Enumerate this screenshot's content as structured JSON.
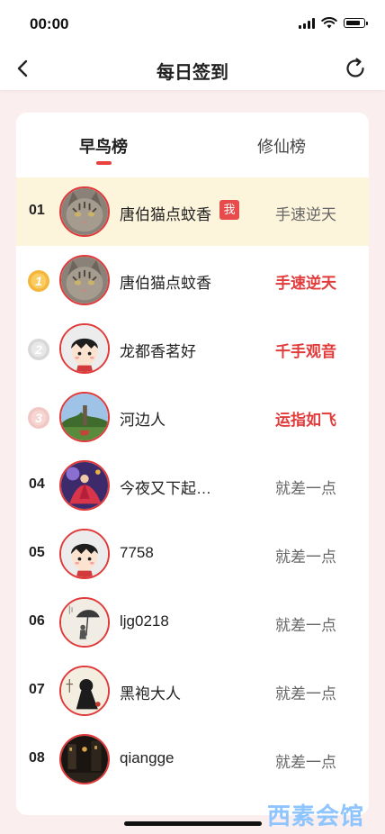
{
  "status_bar": {
    "time": "00:00"
  },
  "header": {
    "title": "每日签到"
  },
  "tabs": [
    {
      "label": "早鸟榜"
    },
    {
      "label": "修仙榜"
    }
  ],
  "rows": [
    {
      "rank": "01",
      "name": "唐伯猫点蚊香",
      "badge": "我",
      "status": "手速逆天",
      "avatar": "cat-avatar",
      "highlight": true
    },
    {
      "rank": "1",
      "name": "唐伯猫点蚊香",
      "status": "手速逆天",
      "avatar": "cat-avatar",
      "medal": "gold"
    },
    {
      "rank": "2",
      "name": "龙都香茗好",
      "status": "千手观音",
      "avatar": "cartoon-boy-avatar",
      "medal": "silver"
    },
    {
      "rank": "3",
      "name": "河边人",
      "status": "运指如飞",
      "avatar": "landscape-avatar",
      "medal": "bronze"
    },
    {
      "rank": "04",
      "name": "今夜又下起…",
      "status": "就差一点",
      "avatar": "dancer-avatar"
    },
    {
      "rank": "05",
      "name": "7758",
      "status": "就差一点",
      "avatar": "cartoon-boy-avatar"
    },
    {
      "rank": "06",
      "name": "ljg0218",
      "status": "就差一点",
      "avatar": "umbrella-avatar"
    },
    {
      "rank": "07",
      "name": "黑袍大人",
      "status": "就差一点",
      "avatar": "ink-figure-avatar"
    },
    {
      "rank": "08",
      "name": "qiangge",
      "status": "就差一点",
      "avatar": "dark-street-avatar"
    }
  ],
  "watermark": "西素会馆",
  "colors": {
    "accent": "#e94040",
    "highlight_row": "#fdf4dc",
    "page_bg": "#fbeeee"
  }
}
